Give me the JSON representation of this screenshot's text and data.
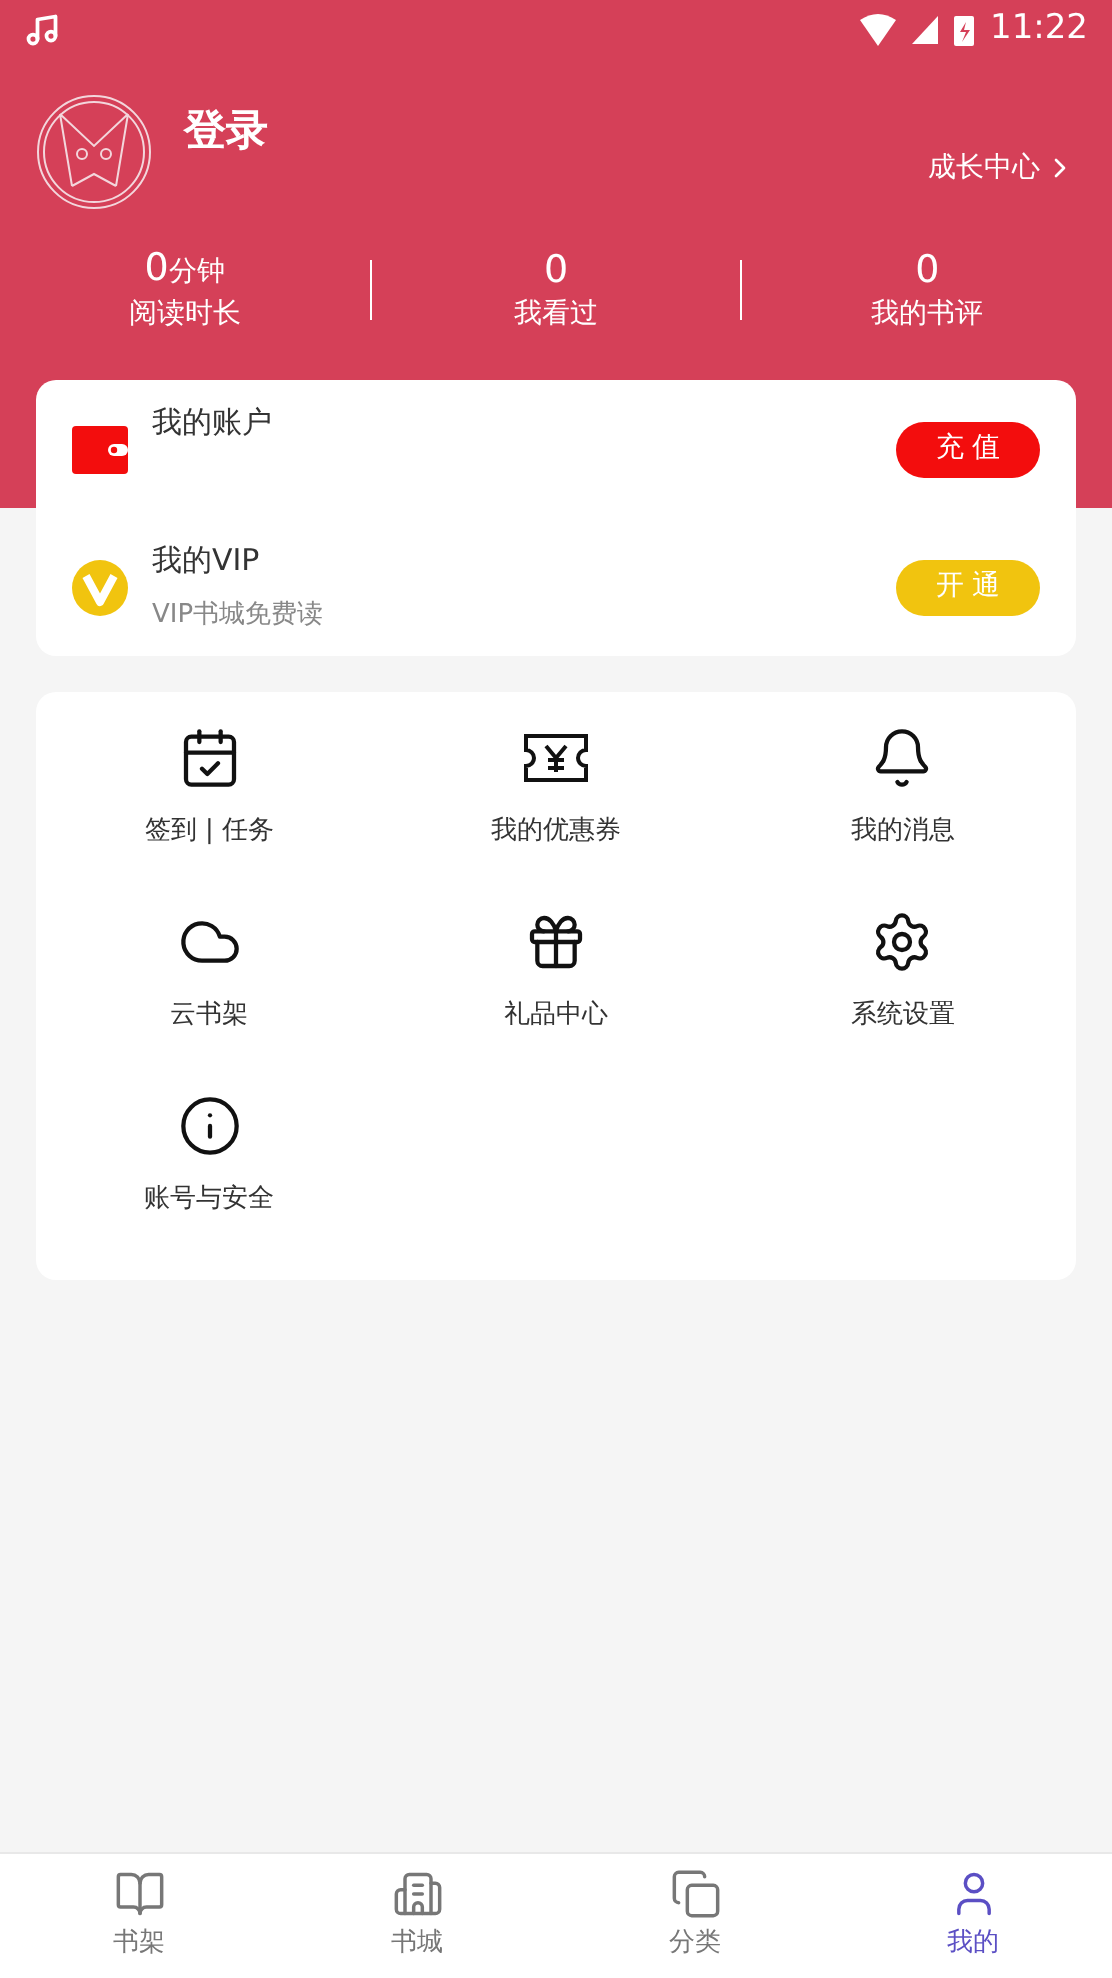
{
  "status_bar": {
    "time": "11:22"
  },
  "profile": {
    "login": "登录",
    "growth_link": "成长中心"
  },
  "stats": [
    {
      "value": "0",
      "unit": "分钟",
      "label": "阅读时长"
    },
    {
      "value": "0",
      "label": "我看过"
    },
    {
      "value": "0",
      "label": "我的书评"
    }
  ],
  "accounts": [
    {
      "kind": "wallet",
      "title": "我的账户",
      "button": "充 值"
    },
    {
      "kind": "vip",
      "title": "我的VIP",
      "subtitle": "VIP书城免费读",
      "button": "开 通"
    }
  ],
  "menu": [
    {
      "kind": "calendar",
      "label": "签到 | 任务"
    },
    {
      "kind": "coupon",
      "label": "我的优惠券"
    },
    {
      "kind": "bell",
      "label": "我的消息"
    },
    {
      "kind": "cloud",
      "label": "云书架"
    },
    {
      "kind": "gift",
      "label": "礼品中心"
    },
    {
      "kind": "settings",
      "label": "系统设置"
    },
    {
      "kind": "info",
      "label": "账号与安全"
    }
  ],
  "bottom_nav": [
    {
      "kind": "shelf",
      "label": "书架",
      "selected": false
    },
    {
      "kind": "store",
      "label": "书城",
      "selected": false
    },
    {
      "kind": "category",
      "label": "分类",
      "selected": false
    },
    {
      "kind": "me",
      "label": "我的",
      "selected": true
    }
  ]
}
